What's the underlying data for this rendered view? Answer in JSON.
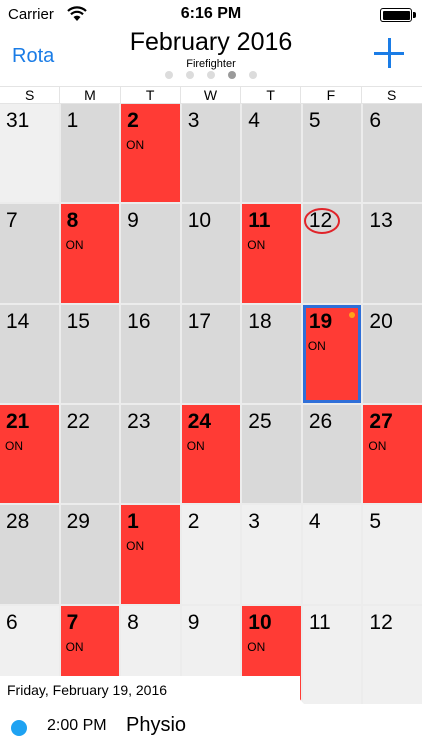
{
  "status_bar": {
    "carrier": "Carrier",
    "time": "6:16 PM"
  },
  "nav": {
    "left_label": "Rota",
    "title": "February 2016",
    "subtitle": "Firefighter",
    "page_count": 5,
    "active_page": 4
  },
  "weekdays": [
    "S",
    "M",
    "T",
    "W",
    "T",
    "F",
    "S"
  ],
  "calendar": {
    "shift_label": "ON",
    "weeks": [
      [
        {
          "d": "31",
          "s": "light"
        },
        {
          "d": "1"
        },
        {
          "d": "2",
          "on": true
        },
        {
          "d": "3"
        },
        {
          "d": "4"
        },
        {
          "d": "5"
        },
        {
          "d": "6"
        }
      ],
      [
        {
          "d": "7"
        },
        {
          "d": "8",
          "on": true
        },
        {
          "d": "9"
        },
        {
          "d": "10"
        },
        {
          "d": "11",
          "on": true
        },
        {
          "d": "12",
          "circled": true
        },
        {
          "d": "13"
        }
      ],
      [
        {
          "d": "14"
        },
        {
          "d": "15"
        },
        {
          "d": "16"
        },
        {
          "d": "17"
        },
        {
          "d": "18"
        },
        {
          "d": "19",
          "on": true,
          "selected": true,
          "marker": true
        },
        {
          "d": "20"
        }
      ],
      [
        {
          "d": "21",
          "on": true
        },
        {
          "d": "22"
        },
        {
          "d": "23"
        },
        {
          "d": "24",
          "on": true
        },
        {
          "d": "25"
        },
        {
          "d": "26"
        },
        {
          "d": "27",
          "on": true
        }
      ],
      [
        {
          "d": "28"
        },
        {
          "d": "29"
        },
        {
          "d": "1",
          "on": true
        },
        {
          "d": "2",
          "s": "light"
        },
        {
          "d": "3",
          "s": "light"
        },
        {
          "d": "4",
          "s": "light"
        },
        {
          "d": "5",
          "s": "light"
        }
      ],
      [
        {
          "d": "6",
          "s": "light"
        },
        {
          "d": "7",
          "on": true
        },
        {
          "d": "8",
          "s": "light"
        },
        {
          "d": "9",
          "s": "light"
        },
        {
          "d": "10",
          "on": true
        },
        {
          "d": "11",
          "s": "light"
        },
        {
          "d": "12",
          "s": "light"
        }
      ]
    ]
  },
  "selected_date": "Friday, February 19, 2016",
  "event": {
    "time": "2:00 PM",
    "title": "Physio",
    "color": "#1ea2f2"
  },
  "colors": {
    "accent": "#1a7ce6",
    "on_shift": "#ff3b35",
    "selected_border": "#2f6fd8",
    "marker": "#ffa21a"
  }
}
